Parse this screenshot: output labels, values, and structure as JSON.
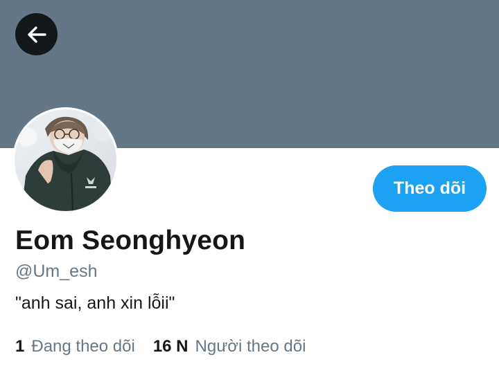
{
  "header": {
    "back_icon": "arrow-left-icon",
    "banner_color": "#657786"
  },
  "profile": {
    "display_name": "Eom Seonghyeon",
    "handle": "@Um_esh",
    "bio": "\"anh sai, anh xin lỗii\"",
    "follow_label": "Theo dõi",
    "avatar": "profile-photo"
  },
  "stats": {
    "following_count": "1",
    "following_label": "Đang theo dõi",
    "followers_count": "16 N",
    "followers_label": "Người theo dõi"
  },
  "colors": {
    "accent": "#1da1f2",
    "text_primary": "#14171a",
    "text_secondary": "#657786"
  }
}
